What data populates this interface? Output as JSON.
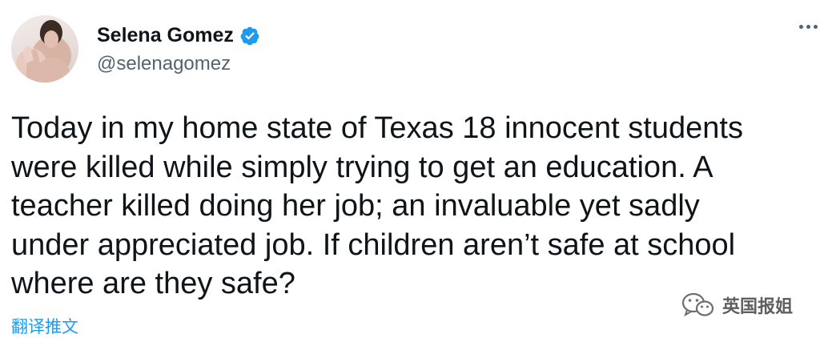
{
  "user": {
    "display_name": "Selena Gomez",
    "handle": "@selenagomez",
    "verified": true
  },
  "tweet": {
    "text": "Today in my home state of Texas 18 innocent students\nwere killed while simply trying to get an education. A\nteacher killed doing her job; an invaluable yet sadly\nunder appreciated job. If children aren’t safe at school\nwhere are they safe?",
    "translate_label": "翻译推文"
  },
  "watermark": {
    "label": "英国报姐"
  },
  "colors": {
    "text": "#0f1419",
    "secondary": "#536471",
    "accent": "#1d9bf0"
  },
  "icons": {
    "verified": "verified-badge-icon",
    "more": "more-options-icon",
    "watermark": "wechat-icon"
  }
}
